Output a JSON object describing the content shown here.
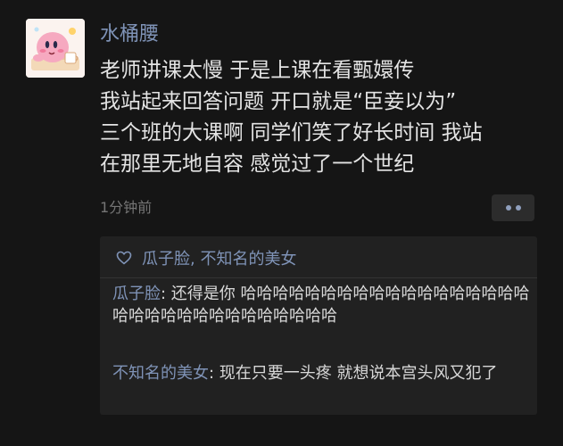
{
  "post": {
    "username": "水桶腰",
    "avatar_icon": "kirby-avatar-icon",
    "text_lines": [
      "老师讲课太慢 于是上课在看甄嬛传",
      "我站起来回答问题 开口就是“臣妾以为”",
      "三个班的大课啊 同学们笑了好长时间 我站",
      "在那里无地自容 感觉过了一个世纪"
    ],
    "time": "1分钟前",
    "more_icon": "more-dots-icon"
  },
  "likes": {
    "icon": "heart-outline-icon",
    "names": "瓜子脸, 不知名的美女"
  },
  "comments": [
    {
      "author": "瓜子脸",
      "separator": ": ",
      "text": "还得是你 哈哈哈哈哈哈哈哈哈哈哈哈哈哈哈哈哈哈哈哈哈哈哈哈哈哈哈哈哈哈哈哈"
    },
    {
      "author": "不知名的美女",
      "separator": ": ",
      "text": "现在只要一头疼 就想说本宫头风又犯了"
    }
  ],
  "colors": {
    "background": "#151515",
    "name_link": "#7f93b7",
    "body_text": "#e4e4e4",
    "muted": "#757575",
    "comment_box": "#212121"
  }
}
